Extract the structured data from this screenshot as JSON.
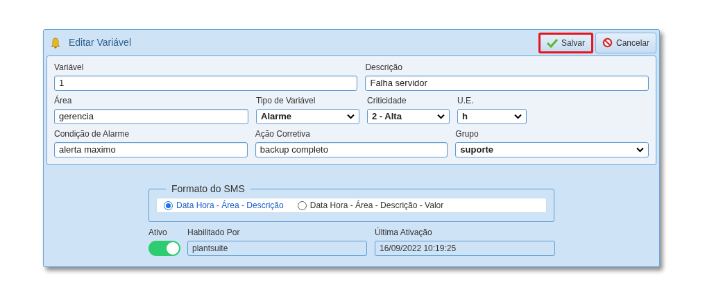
{
  "dialog": {
    "title": "Editar Variável"
  },
  "buttons": [
    {
      "kind": "save",
      "label": "Salvar",
      "highlighted": true
    },
    {
      "kind": "cancel",
      "label": "Cancelar",
      "highlighted": false
    }
  ],
  "form_rows": [
    [
      {
        "kind": "text",
        "label": "Variável",
        "value": "1"
      },
      {
        "kind": "text",
        "label": "Descrição",
        "value": "Falha servidor"
      }
    ],
    [
      {
        "kind": "text",
        "label": "Área",
        "value": "gerencia"
      },
      {
        "kind": "select",
        "label": "Tipo de Variável",
        "value": "Alarme"
      },
      {
        "kind": "select",
        "label": "Criticidade",
        "value": "2 - Alta"
      },
      {
        "kind": "select",
        "label": "U.E.",
        "value": "h"
      }
    ],
    [
      {
        "kind": "text",
        "label": "Condição de Alarme",
        "value": "alerta maximo"
      },
      {
        "kind": "text",
        "label": "Ação Corretiva",
        "value": "backup completo"
      },
      {
        "kind": "select",
        "label": "Grupo",
        "value": "suporte"
      }
    ]
  ],
  "sms_format": {
    "legend": "Formato do SMS",
    "options": [
      {
        "label": "Data Hora - Área - Descrição",
        "selected": true
      },
      {
        "label": "Data Hora - Área - Descrição - Valor",
        "selected": false
      }
    ]
  },
  "status": {
    "active_label": "Ativo",
    "active": true,
    "enabled_by_label": "Habilitado Por",
    "enabled_by": "plantsuite",
    "last_activation_label": "Última Ativação",
    "last_activation": "16/09/2022 10:19:25"
  }
}
